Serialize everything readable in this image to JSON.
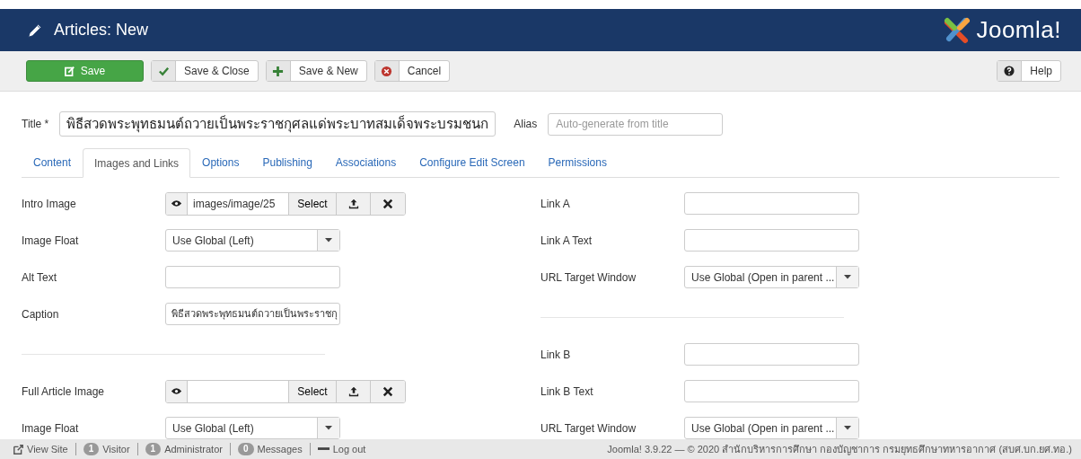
{
  "header": {
    "title": "Articles: New",
    "logo": "Joomla!"
  },
  "toolbar": {
    "buttons": [
      {
        "label": "Save",
        "kind": "primary"
      },
      {
        "label": "Save & Close",
        "kind": "confirm"
      },
      {
        "label": "Save & New",
        "kind": "add"
      },
      {
        "label": "Cancel",
        "kind": "cancel"
      }
    ],
    "help": {
      "label": "Help"
    }
  },
  "title_field": {
    "label": "Title *",
    "value": "พิธีสวดพระพุทธมนต์ถวายเป็นพระราชกุศลแด่พระบาทสมเด็จพระบรมชนก"
  },
  "alias_field": {
    "label": "Alias",
    "placeholder": "Auto-generate from title"
  },
  "tabs": [
    {
      "label": "Content",
      "selected": false
    },
    {
      "label": "Images and Links",
      "selected": true
    },
    {
      "label": "Options",
      "selected": false
    },
    {
      "label": "Publishing",
      "selected": false
    },
    {
      "label": "Associations",
      "selected": false
    },
    {
      "label": "Configure Edit Screen",
      "selected": false
    },
    {
      "label": "Permissions",
      "selected": false
    }
  ],
  "left_column": [
    {
      "kind": "media",
      "label": "Intro Image",
      "value": "images/image/25",
      "button": "Select"
    },
    {
      "kind": "select",
      "label": "Image Float",
      "value": "Use Global (Left)"
    },
    {
      "kind": "text",
      "label": "Alt Text"
    },
    {
      "kind": "text",
      "label": "Caption",
      "value": "พิธีสวดพระพุทธมนต์ถวายเป็นพระราชกุ"
    },
    {
      "kind": "divider"
    },
    {
      "kind": "media",
      "label": "Full Article Image",
      "button": "Select"
    },
    {
      "kind": "select",
      "label": "Image Float",
      "value": "Use Global (Left)"
    }
  ],
  "right_column": [
    {
      "kind": "text",
      "label": "Link A"
    },
    {
      "kind": "text",
      "label": "Link A Text"
    },
    {
      "kind": "select",
      "label": "URL Target Window",
      "value": "Use Global (Open in parent ..."
    },
    {
      "kind": "divider"
    },
    {
      "kind": "text",
      "label": "Link B"
    },
    {
      "kind": "text",
      "label": "Link B Text"
    },
    {
      "kind": "select",
      "label": "URL Target Window",
      "value": "Use Global (Open in parent ..."
    }
  ],
  "status_bar": {
    "items": [
      {
        "kind": "link",
        "label": "View Site"
      },
      {
        "kind": "count",
        "count": "1",
        "label": "Visitor"
      },
      {
        "kind": "count",
        "count": "1",
        "label": "Administrator"
      },
      {
        "kind": "count",
        "count": "0",
        "label": "Messages"
      },
      {
        "kind": "logout",
        "label": "Log out"
      }
    ],
    "copyright": "Joomla! 3.9.22 — © 2020 สำนักบริหารการศึกษา กองบัญชาการ กรมยุทธศึกษาทหารอากาศ (สบศ.บก.ยศ.ทอ.)"
  }
}
